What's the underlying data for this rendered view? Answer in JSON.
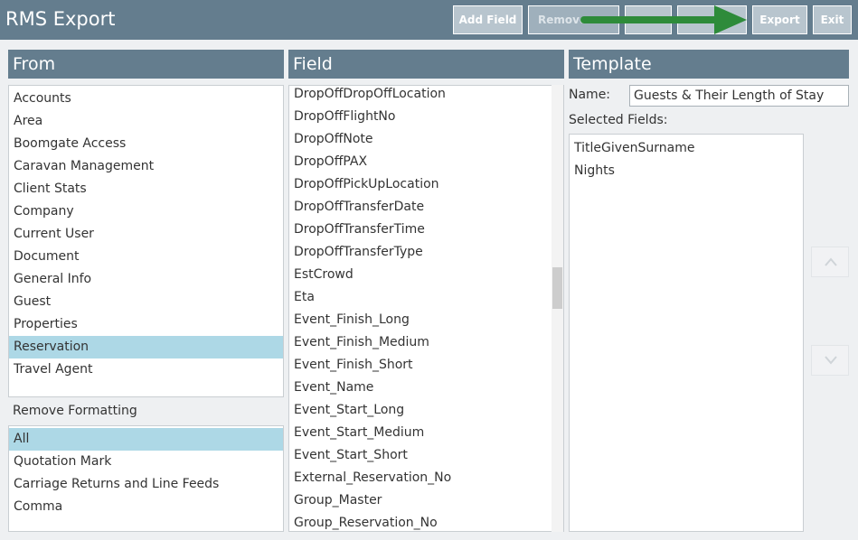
{
  "app": {
    "title": "RMS Export"
  },
  "toolbar": {
    "add_field": "Add Field",
    "remove": "Remove",
    "blank1": "",
    "blank2": "",
    "export": "Export",
    "exit": "Exit"
  },
  "from": {
    "header": "From",
    "items": [
      {
        "label": "Accounts"
      },
      {
        "label": "Area"
      },
      {
        "label": "Boomgate Access"
      },
      {
        "label": "Caravan Management"
      },
      {
        "label": "Client Stats"
      },
      {
        "label": "Company"
      },
      {
        "label": "Current User"
      },
      {
        "label": "Document"
      },
      {
        "label": "General Info"
      },
      {
        "label": "Guest"
      },
      {
        "label": "Properties"
      },
      {
        "label": "Reservation"
      },
      {
        "label": "Travel Agent"
      }
    ],
    "selected": "Reservation"
  },
  "remove_formatting": {
    "label": "Remove Formatting",
    "items": [
      {
        "label": "All"
      },
      {
        "label": "Quotation Mark"
      },
      {
        "label": "Carriage Returns and Line Feeds"
      },
      {
        "label": "Comma"
      }
    ],
    "selected": "All"
  },
  "field": {
    "header": "Field",
    "items": [
      {
        "label": "DropOffDropOffLocation"
      },
      {
        "label": "DropOffFlightNo"
      },
      {
        "label": "DropOffNote"
      },
      {
        "label": "DropOffPAX"
      },
      {
        "label": "DropOffPickUpLocation"
      },
      {
        "label": "DropOffTransferDate"
      },
      {
        "label": "DropOffTransferTime"
      },
      {
        "label": "DropOffTransferType"
      },
      {
        "label": "EstCrowd"
      },
      {
        "label": "Eta"
      },
      {
        "label": "Event_Finish_Long"
      },
      {
        "label": "Event_Finish_Medium"
      },
      {
        "label": "Event_Finish_Short"
      },
      {
        "label": "Event_Name"
      },
      {
        "label": "Event_Start_Long"
      },
      {
        "label": "Event_Start_Medium"
      },
      {
        "label": "Event_Start_Short"
      },
      {
        "label": "External_Reservation_No"
      },
      {
        "label": "Group_Master"
      },
      {
        "label": "Group_Reservation_No"
      }
    ]
  },
  "template": {
    "header": "Template",
    "name_label": "Name:",
    "name_value": "Guests & Their Length of Stay",
    "selected_fields_label": "Selected Fields:",
    "selected_fields": [
      {
        "label": "TitleGivenSurname"
      },
      {
        "label": "Nights"
      }
    ]
  },
  "icons": {
    "move_up": "chevron-up-icon",
    "move_down": "chevron-down-icon",
    "annotation": "green-arrow-icon"
  },
  "colors": {
    "header_bg": "#647d8e",
    "selected_bg": "#add8e6",
    "annotation_arrow": "#2e8b3a"
  }
}
